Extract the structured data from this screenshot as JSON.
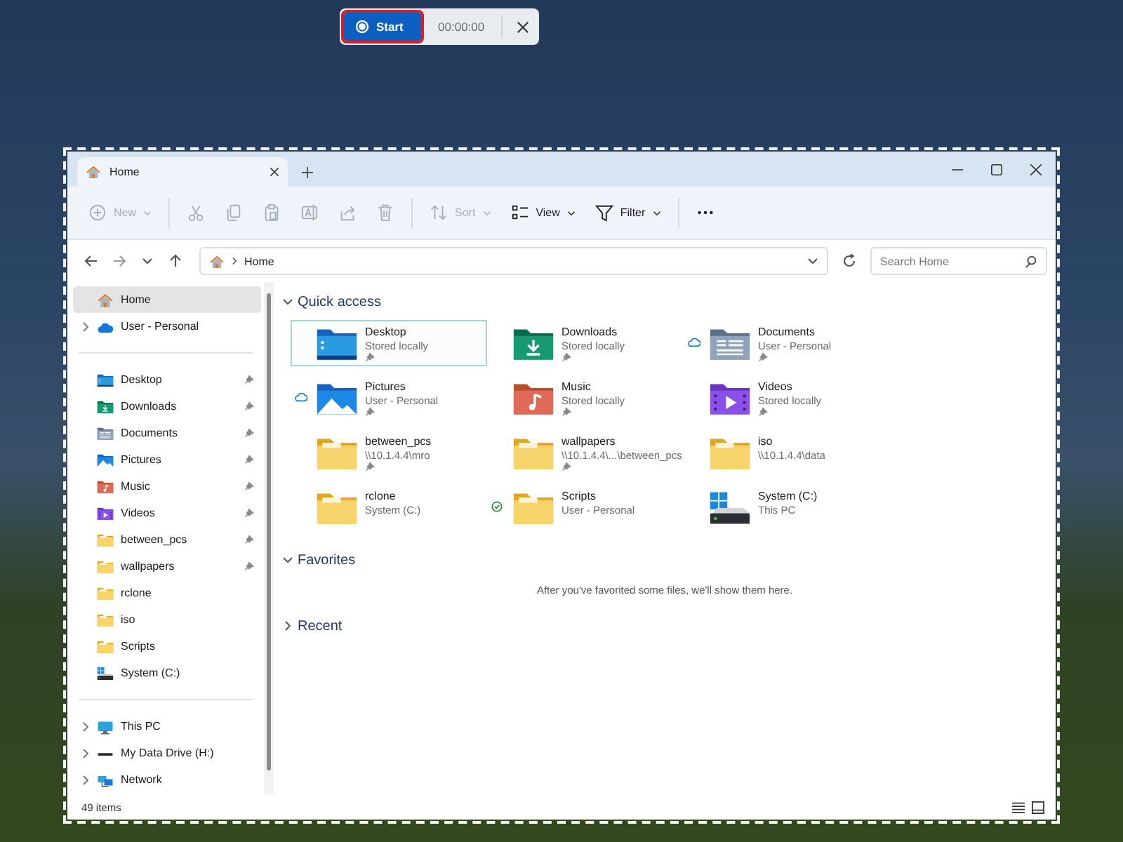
{
  "recorder": {
    "start_label": "Start",
    "focused": true,
    "timer": "00:00:00"
  },
  "tabs": [
    {
      "title": "Home",
      "selected": true
    }
  ],
  "toolbar": [
    {
      "kind": "new",
      "label": "New",
      "disabled": true
    },
    {
      "kind": "separator"
    },
    {
      "kind": "cut",
      "disabled": true
    },
    {
      "kind": "copy",
      "disabled": true
    },
    {
      "kind": "paste",
      "disabled": true
    },
    {
      "kind": "rename",
      "disabled": true
    },
    {
      "kind": "share",
      "disabled": true
    },
    {
      "kind": "delete",
      "disabled": true
    },
    {
      "kind": "separator"
    },
    {
      "kind": "sort",
      "label": "Sort",
      "disabled": true
    },
    {
      "kind": "view",
      "label": "View",
      "disabled": false
    },
    {
      "kind": "filter",
      "label": "Filter",
      "disabled": false
    },
    {
      "kind": "separator"
    },
    {
      "kind": "more",
      "disabled": false
    }
  ],
  "address": {
    "path": "Home",
    "search_placeholder": "Search Home"
  },
  "sidebar": {
    "groups": [
      {
        "items": [
          {
            "label": "Home",
            "kind": "home",
            "expandable": false,
            "pinned": false,
            "selected": true
          },
          {
            "label": "User - Personal",
            "kind": "cloud",
            "expandable": true,
            "pinned": false,
            "selected": false
          }
        ]
      },
      {
        "items": [
          {
            "label": "Desktop",
            "kind": "desktop",
            "expandable": false,
            "pinned": true,
            "selected": false
          },
          {
            "label": "Downloads",
            "kind": "downloads",
            "expandable": false,
            "pinned": true,
            "selected": false
          },
          {
            "label": "Documents",
            "kind": "documents",
            "expandable": false,
            "pinned": true,
            "selected": false
          },
          {
            "label": "Pictures",
            "kind": "pictures",
            "expandable": false,
            "pinned": true,
            "selected": false
          },
          {
            "label": "Music",
            "kind": "music",
            "expandable": false,
            "pinned": true,
            "selected": false
          },
          {
            "label": "Videos",
            "kind": "videos",
            "expandable": false,
            "pinned": true,
            "selected": false
          },
          {
            "label": "between_pcs",
            "kind": "folder",
            "expandable": false,
            "pinned": true,
            "selected": false
          },
          {
            "label": "wallpapers",
            "kind": "folder",
            "expandable": false,
            "pinned": true,
            "selected": false
          },
          {
            "label": "rclone",
            "kind": "folder",
            "expandable": false,
            "pinned": false,
            "selected": false
          },
          {
            "label": "iso",
            "kind": "folder",
            "expandable": false,
            "pinned": false,
            "selected": false
          },
          {
            "label": "Scripts",
            "kind": "folder",
            "expandable": false,
            "pinned": false,
            "selected": false
          },
          {
            "label": "System (C:)",
            "kind": "drive",
            "expandable": false,
            "pinned": false,
            "selected": false
          }
        ]
      },
      {
        "items": [
          {
            "label": "This PC",
            "kind": "pc",
            "expandable": true,
            "pinned": false,
            "selected": false
          },
          {
            "label": "My Data Drive (H:)",
            "kind": "disk",
            "expandable": true,
            "pinned": false,
            "selected": false
          },
          {
            "label": "Network",
            "kind": "network",
            "expandable": true,
            "pinned": false,
            "selected": false
          }
        ]
      }
    ]
  },
  "sections": [
    {
      "title": "Quick access",
      "expanded": true,
      "items": [
        {
          "name": "Desktop",
          "location": "Stored locally",
          "kind": "desktop",
          "cloud": false,
          "synced": false,
          "pinned": true,
          "selected": true
        },
        {
          "name": "Downloads",
          "location": "Stored locally",
          "kind": "downloads",
          "cloud": false,
          "synced": false,
          "pinned": true,
          "selected": false
        },
        {
          "name": "Documents",
          "location": "User - Personal",
          "kind": "documents",
          "cloud": true,
          "synced": false,
          "pinned": true,
          "selected": false
        },
        {
          "name": "Pictures",
          "location": "User - Personal",
          "kind": "pictures",
          "cloud": true,
          "synced": false,
          "pinned": true,
          "selected": false
        },
        {
          "name": "Music",
          "location": "Stored locally",
          "kind": "music",
          "cloud": false,
          "synced": false,
          "pinned": true,
          "selected": false
        },
        {
          "name": "Videos",
          "location": "Stored locally",
          "kind": "videos",
          "cloud": false,
          "synced": false,
          "pinned": true,
          "selected": false
        },
        {
          "name": "between_pcs",
          "location": "\\\\10.1.4.4\\mro",
          "kind": "folder",
          "cloud": false,
          "synced": false,
          "pinned": true,
          "selected": false
        },
        {
          "name": "wallpapers",
          "location": "\\\\10.1.4.4\\...\\between_pcs",
          "kind": "folder",
          "cloud": false,
          "synced": false,
          "pinned": true,
          "selected": false
        },
        {
          "name": "iso",
          "location": "\\\\10.1.4.4\\data",
          "kind": "folder",
          "cloud": false,
          "synced": false,
          "pinned": false,
          "selected": false
        },
        {
          "name": "rclone",
          "location": "System (C:)",
          "kind": "folder",
          "cloud": false,
          "synced": false,
          "pinned": false,
          "selected": false
        },
        {
          "name": "Scripts",
          "location": "User - Personal",
          "kind": "folder",
          "cloud": false,
          "synced": true,
          "pinned": false,
          "selected": false
        },
        {
          "name": "System (C:)",
          "location": "This PC",
          "kind": "drive",
          "cloud": false,
          "synced": false,
          "pinned": false,
          "selected": false
        }
      ]
    },
    {
      "title": "Favorites",
      "expanded": true,
      "empty_text": "After you've favorited some files, we'll show them here."
    },
    {
      "title": "Recent",
      "expanded": false
    }
  ],
  "status_bar": {
    "count": "49 items"
  }
}
